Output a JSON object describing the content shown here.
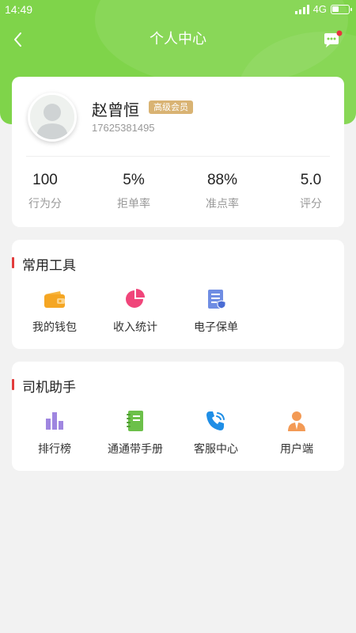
{
  "status_bar": {
    "time": "14:49",
    "network": "4G"
  },
  "nav": {
    "title": "个人中心",
    "back_icon": "chevron-left-icon",
    "message_icon": "chat-bubble-icon"
  },
  "colors": {
    "header_green": "#7fd44a",
    "badge_gold": "#d9b373",
    "section_accent": "#e23b3b",
    "notification_dot": "#e8343b"
  },
  "profile": {
    "name": "赵曾恒",
    "badge": "高级会员",
    "phone": "17625381495",
    "stats": [
      {
        "value": "100",
        "label": "行为分"
      },
      {
        "value": "5%",
        "label": "拒单率"
      },
      {
        "value": "88%",
        "label": "准点率"
      },
      {
        "value": "5.0",
        "label": "评分"
      }
    ]
  },
  "tools": {
    "title": "常用工具",
    "items": [
      {
        "label": "我的钱包",
        "icon": "wallet-icon"
      },
      {
        "label": "收入统计",
        "icon": "pie-chart-icon"
      },
      {
        "label": "电子保单",
        "icon": "insurance-document-icon"
      }
    ]
  },
  "assistant": {
    "title": "司机助手",
    "items": [
      {
        "label": "排行榜",
        "icon": "ranking-bar-icon"
      },
      {
        "label": "通通带手册",
        "icon": "notebook-icon"
      },
      {
        "label": "客服中心",
        "icon": "phone-call-icon"
      },
      {
        "label": "用户端",
        "icon": "user-icon"
      }
    ]
  }
}
